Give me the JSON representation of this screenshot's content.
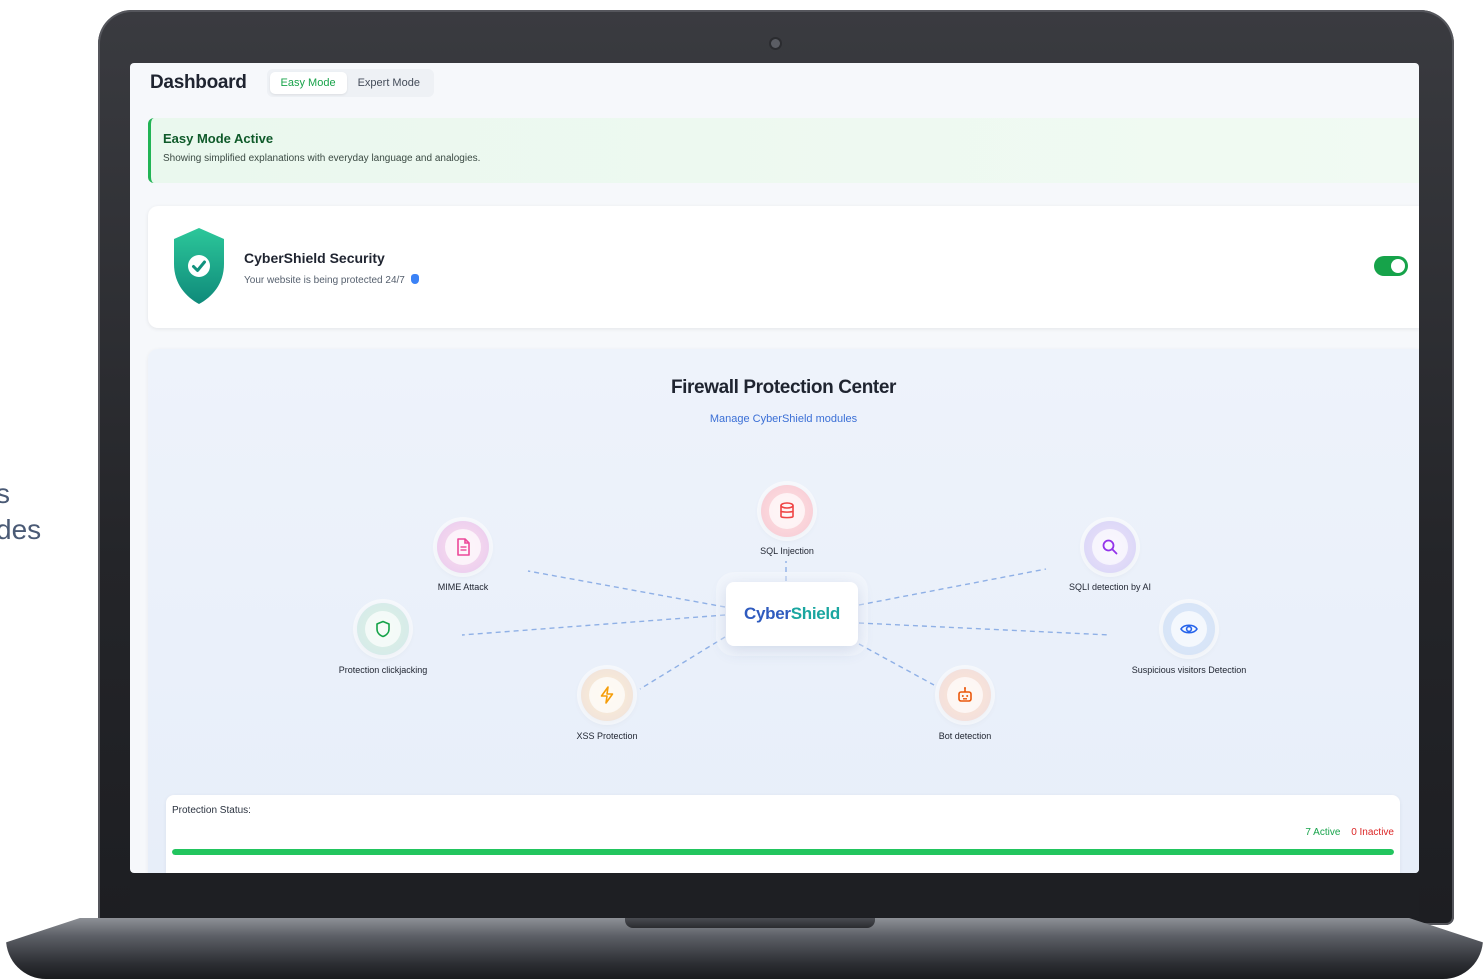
{
  "side_text": {
    "line1": "s",
    "line2": "des"
  },
  "header": {
    "title": "Dashboard",
    "tabs": [
      {
        "label": "Easy Mode",
        "active": true
      },
      {
        "label": "Expert Mode",
        "active": false
      }
    ]
  },
  "banner": {
    "title": "Easy Mode Active",
    "subtitle": "Showing simplified explanations with everyday language and analogies."
  },
  "security_card": {
    "title": "CyberShield Security",
    "subtitle": "Your website is being protected 24/7",
    "toggle_on": true,
    "accent_color": "#16a34a"
  },
  "firewall": {
    "title": "Firewall Protection Center",
    "subtitle": "Manage CyberShield modules",
    "center_logo": {
      "part1": "Cyber",
      "part2": "Shield"
    },
    "modules": [
      {
        "label": "SQL Injection",
        "icon": "database-icon",
        "color": "#ef4444"
      },
      {
        "label": "MIME Attack",
        "icon": "file-icon",
        "color": "#ec4899"
      },
      {
        "label": "SQLI detection by AI",
        "icon": "search-icon",
        "color": "#9333ea"
      },
      {
        "label": "Protection clickjacking",
        "icon": "shield-icon",
        "color": "#16a34a"
      },
      {
        "label": "Suspicious visitors Detection",
        "icon": "eye-icon",
        "color": "#2563eb"
      },
      {
        "label": "XSS Protection",
        "icon": "bolt-icon",
        "color": "#f59e0b"
      },
      {
        "label": "Bot detection",
        "icon": "bot-icon",
        "color": "#ea580c"
      }
    ]
  },
  "status": {
    "label": "Protection Status:",
    "active_text": "7 Active",
    "inactive_text": "0 Inactive",
    "active_fraction": 1.0
  }
}
